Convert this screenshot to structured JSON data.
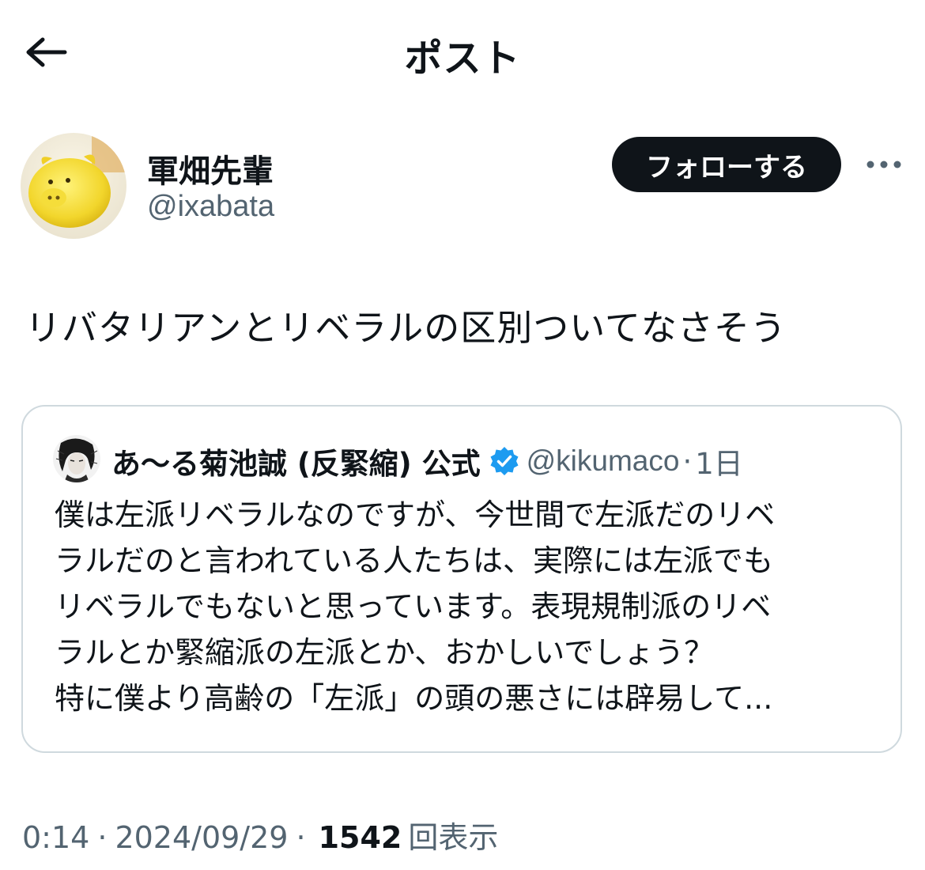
{
  "header": {
    "title": "ポスト",
    "back_icon": "arrow-left-icon"
  },
  "author": {
    "name": "軍畑先輩",
    "handle": "@ixabata",
    "follow_label": "フォローする",
    "more_icon": "more-horizontal-icon"
  },
  "tweet": {
    "text": "リバタリアンとリベラルの区別ついてなさそう"
  },
  "quote": {
    "name": "あ〜る菊池誠 (反緊縮) 公式",
    "verified_icon": "verified-badge-icon",
    "handle": "@kikumaco",
    "separator": "·",
    "time": "1日",
    "lines": [
      "僕は左派リベラルなのですが、今世間で左派だのリベ",
      "ラルだのと言われている人たちは、実際には左派でも",
      "リベラルでもないと思っています。表現規制派のリベ",
      "ラルとか緊縮派の左派とか、おかしいでしょう？",
      "特に僕より高齢の「左派」の頭の悪さには辟易して..."
    ]
  },
  "meta": {
    "time": "0:14",
    "date": "2024/09/29",
    "separator": "·",
    "views_count": "1542",
    "views_label": "回表示"
  },
  "colors": {
    "text_primary": "#0f1419",
    "text_secondary": "#536471",
    "border": "#cfd9de",
    "verified": "#1d9bf0",
    "follow_bg": "#0f1419"
  }
}
